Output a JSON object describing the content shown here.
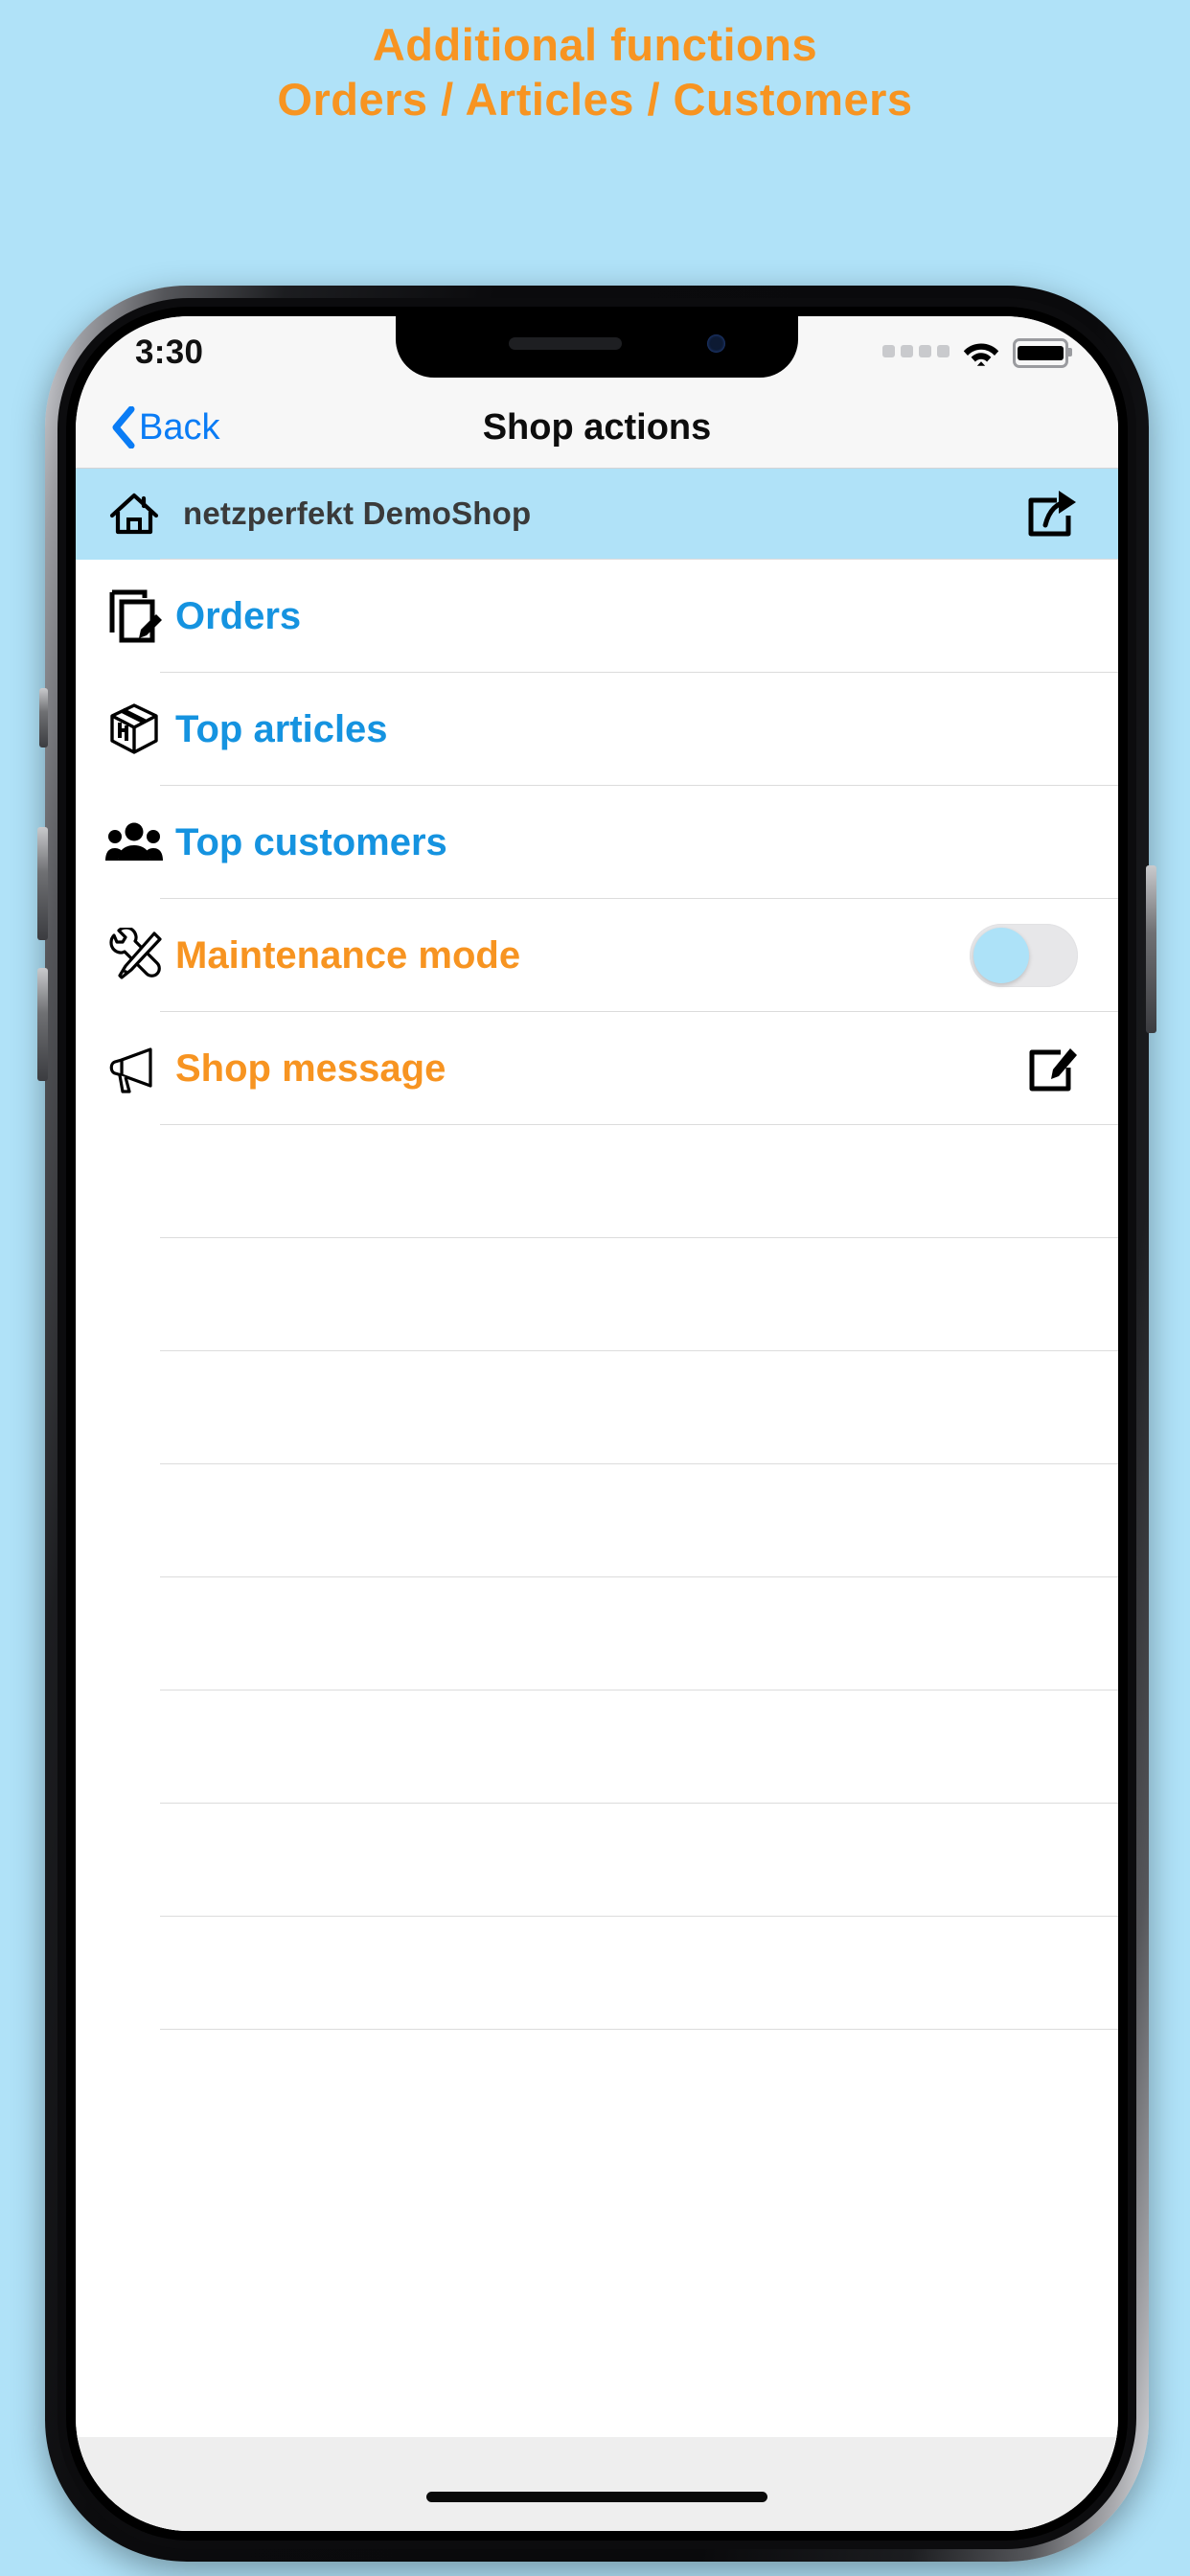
{
  "promo": {
    "title": "Additional functions",
    "subtitle": "Orders / Articles / Customers",
    "accent_color": "#f79421",
    "background_color": "#b0e2f8"
  },
  "status_bar": {
    "time": "3:30",
    "signal_icon": "signal-dots-icon",
    "wifi_icon": "wifi-icon",
    "battery_icon": "battery-full-icon"
  },
  "nav_bar": {
    "back_label": "Back",
    "back_icon": "chevron-left-icon",
    "title": "Shop actions",
    "tint_color": "#0a7cf5"
  },
  "shop_row": {
    "icon": "home-icon",
    "name": "netzperfekt DemoShop",
    "accessory_icon": "share-icon",
    "highlight_color": "#b0e2f8"
  },
  "menu_items": [
    {
      "icon": "documents-edit-icon",
      "label": "Orders",
      "color": "#1593e0",
      "accessory": "none"
    },
    {
      "icon": "package-box-icon",
      "label": "Top articles",
      "color": "#1593e0",
      "accessory": "none"
    },
    {
      "icon": "people-group-icon",
      "label": "Top customers",
      "color": "#1593e0",
      "accessory": "none"
    },
    {
      "icon": "wrench-screwdriver-icon",
      "label": "Maintenance mode",
      "color": "#f79421",
      "accessory": "toggle",
      "toggle_state": "off"
    },
    {
      "icon": "megaphone-icon",
      "label": "Shop message",
      "color": "#f79421",
      "accessory": "compose-icon"
    }
  ]
}
